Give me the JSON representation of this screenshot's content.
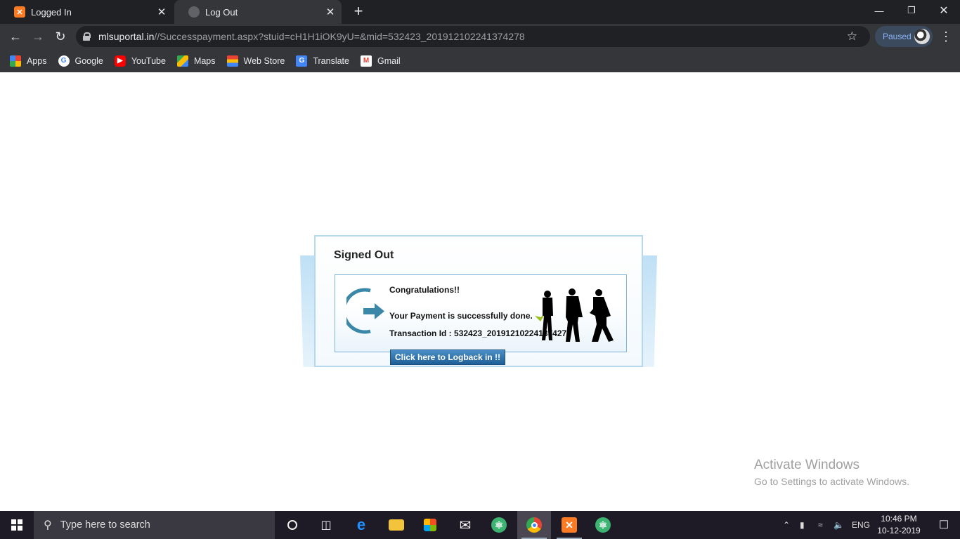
{
  "browser": {
    "tabs": [
      {
        "title": "Logged In",
        "favicon": "xampp-icon",
        "active": false
      },
      {
        "title": "Log Out",
        "favicon": "globe-icon",
        "active": true
      }
    ],
    "new_tab_glyph": "+",
    "omnibox": {
      "host": "mlsuportal.in",
      "path": "//Successpayment.aspx?stuid=cH1H1iOK9yU=&mid=532423_20191210224137427­8"
    },
    "profile_status": "Paused",
    "bookmarks": [
      {
        "label": "Apps",
        "icon": "apps-icon"
      },
      {
        "label": "Google",
        "icon": "google-icon"
      },
      {
        "label": "YouTube",
        "icon": "youtube-icon"
      },
      {
        "label": "Maps",
        "icon": "maps-icon"
      },
      {
        "label": "Web Store",
        "icon": "webstore-icon"
      },
      {
        "label": "Translate",
        "icon": "translate-icon"
      },
      {
        "label": "Gmail",
        "icon": "gmail-icon"
      }
    ]
  },
  "signout": {
    "title": "Signed Out",
    "congrats": "Congratulations!!",
    "payment_message": "Your Payment is successfully done.",
    "transaction_label": "Transaction Id : 532423_20191210224137427­8",
    "logback_button": "Click here to Logback in !!"
  },
  "watermark": {
    "line1": "Activate Windows",
    "line2": "Go to Settings to activate Windows."
  },
  "taskbar": {
    "search_placeholder": "Type here to search",
    "language": "ENG",
    "time": "10:46 PM",
    "date": "10-12-2019"
  },
  "colors": {
    "panel_border": "#b5d8ef",
    "inner_border": "#7fb3d8",
    "button_blue": "#1f5f97",
    "arrow_teal": "#3a87a8",
    "check_green": "#9bbf1e"
  }
}
